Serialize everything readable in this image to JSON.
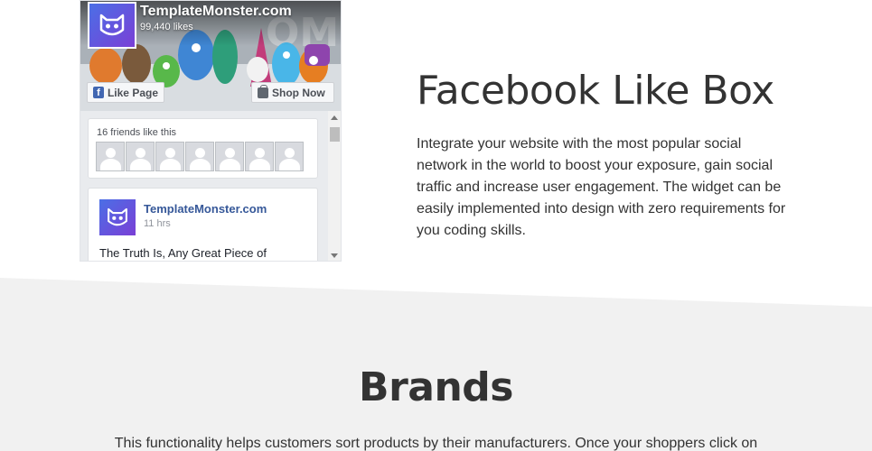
{
  "facebook_widget": {
    "page_name": "TemplateMonster.com",
    "likes": "99,440 likes",
    "like_button": "Like Page",
    "shop_button": "Shop Now",
    "friends_label": "16 friends like this",
    "friends_count_shown": 7,
    "post": {
      "author": "TemplateMonster.com",
      "time": "11 hrs",
      "text": "The Truth Is, Any Great Piece of"
    },
    "colors": {
      "facebook_blue": "#4267b2",
      "link_blue": "#365899",
      "brand_gradient_start": "#4b6fe6",
      "brand_gradient_end": "#7a3fd6"
    }
  },
  "feature": {
    "title": "Facebook Like Box",
    "description": "Integrate your website with the most popular social network in the world to boost your exposure, gain social traffic and increase user engagement. The widget can be easily implemented into design with zero requirements for you coding skills."
  },
  "brands": {
    "title": "Brands",
    "description": "This functionality helps customers sort products by their manufacturers. Once your shoppers click on"
  },
  "colors": {
    "background": "#ffffff",
    "grey_band": "#f1f1f1",
    "text": "#333333"
  }
}
